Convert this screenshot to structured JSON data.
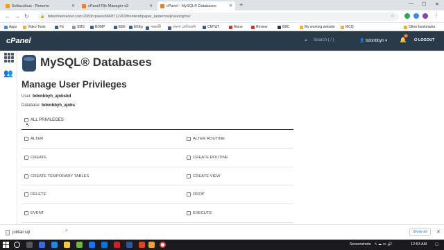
{
  "browser": {
    "tabs": [
      {
        "title": "Softaculous - Remove",
        "favicon_color": "#f29a2e",
        "active": false
      },
      {
        "title": "cPanel File Manager v3",
        "favicon_color": "#f57c20",
        "active": false
      },
      {
        "title": "cPanel - MySQL® Databases",
        "favicon_color": "#f57c20",
        "active": true
      }
    ],
    "new_tab": "+",
    "window_controls": {
      "minimize": "—",
      "maximize": "☐",
      "close": "✕"
    },
    "address": "bdonlinemarket.com:2083/cpsess5668712263/frontend/paper_lantern/sql/userrights/",
    "bookmarks": [
      {
        "label": "Apps",
        "color": "#4285f4"
      },
      {
        "label": "Video Tools",
        "color": "#f2b01e"
      },
      {
        "label": "Fb",
        "color": "#3b5998"
      },
      {
        "label": "SMS",
        "color": "#999999"
      },
      {
        "label": "BDMP",
        "color": "#3b5998"
      },
      {
        "label": "EEE",
        "color": "#3b5998"
      },
      {
        "label": "EEEg",
        "color": "#3b5998"
      },
      {
        "label": "সরকারী",
        "color": "#3b5998"
      },
      {
        "label": "বাংলা প্রেসিডেন্ট",
        "color": "#3b5998"
      },
      {
        "label": "CMT&T",
        "color": "#3b5998"
      },
      {
        "label": "Alone",
        "color": "#d93025"
      },
      {
        "label": "Review",
        "color": "#d93025"
      },
      {
        "label": "BBC",
        "color": "#333333"
      },
      {
        "label": "My working website",
        "color": "#f2b01e"
      },
      {
        "label": "MCQ",
        "color": "#f2b01e"
      },
      {
        "label": "Other bookmarks",
        "color": "#f2b01e"
      }
    ]
  },
  "cpanel": {
    "logo": "cPanel",
    "search_placeholder": "Search ( / )",
    "username": "bdonbbyh",
    "notification_count": "4",
    "logout_label": "LOGOUT"
  },
  "page": {
    "title": "MySQL® Databases",
    "subtitle": "Manage User Privileges",
    "user_label": "User:",
    "user_value": "bdonbbyh_ajobsbd",
    "database_label": "Database:",
    "database_value": "bdonbbyh_ajobs",
    "all_privileges": "ALL PRIVILEGES",
    "privileges": [
      [
        "ALTER",
        "ALTER ROUTINE"
      ],
      [
        "CREATE",
        "CREATE ROUTINE"
      ],
      [
        "CREATE TEMPORARY TABLES",
        "CREATE VIEW"
      ],
      [
        "DELETE",
        "DROP"
      ],
      [
        "EVENT",
        "EXECUTE"
      ]
    ]
  },
  "downloads": {
    "file": "jobfair.sql",
    "show_all": "Show all"
  },
  "taskbar": {
    "screenshots_label": "Screenshots",
    "time": "12:53 AM"
  }
}
